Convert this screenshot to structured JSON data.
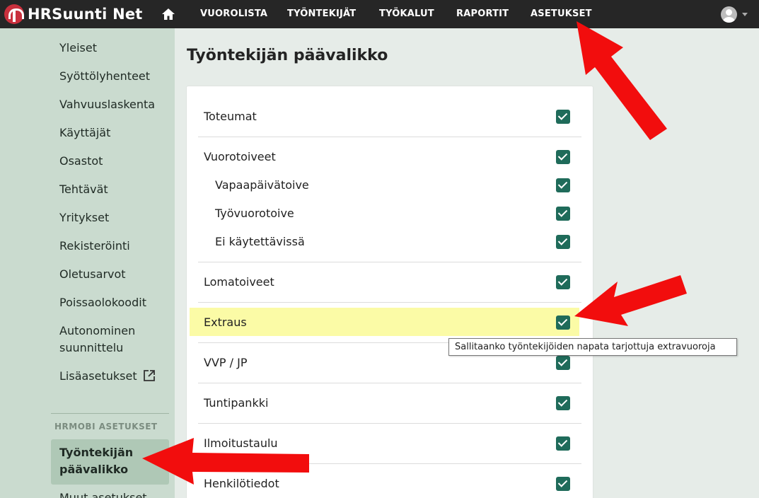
{
  "brand": {
    "name": "HRSuunti Net"
  },
  "nav": {
    "items": [
      "VUOROLISTA",
      "TYÖNTEKIJÄT",
      "TYÖKALUT",
      "RAPORTIT",
      "ASETUKSET"
    ]
  },
  "sidebar": {
    "items": [
      "Yleiset",
      "Syöttölyhenteet",
      "Vahvuuslaskenta",
      "Käyttäjät",
      "Osastot",
      "Tehtävät",
      "Yritykset",
      "Rekisteröinti",
      "Oletusarvot",
      "Poissaolokoodit",
      "Autonominen",
      "suunnittelu",
      "Lisäasetukset"
    ],
    "section_title": "HRMOBI ASETUKSET",
    "active_line1": "Työntekijän",
    "active_line2": "päävalikko",
    "next_item": "Muut asetukset"
  },
  "main": {
    "title": "Työntekijän päävalikko",
    "rows": [
      "Toteumat",
      "Vuorotoiveet",
      "Vapaapäivätoive",
      "Työvuorotoive",
      "Ei käytettävissä",
      "Lomatoiveet",
      "Extraus",
      "VVP / JP",
      "Tuntipankki",
      "Ilmoitustaulu",
      "Henkilötiedot"
    ],
    "tooltip": "Sallitaanko työntekijöiden napata tarjottuja extravuoroja"
  },
  "colors": {
    "topbar": "#262626",
    "sidebar": "#cadbcf",
    "checkbox": "#1f6b5a",
    "highlight": "#fbfba6",
    "arrow": "#f20d0d"
  },
  "icons": [
    "home-icon",
    "avatar-icon",
    "external-link-icon",
    "checkbox-checked-icon",
    "arrow-annotation"
  ]
}
